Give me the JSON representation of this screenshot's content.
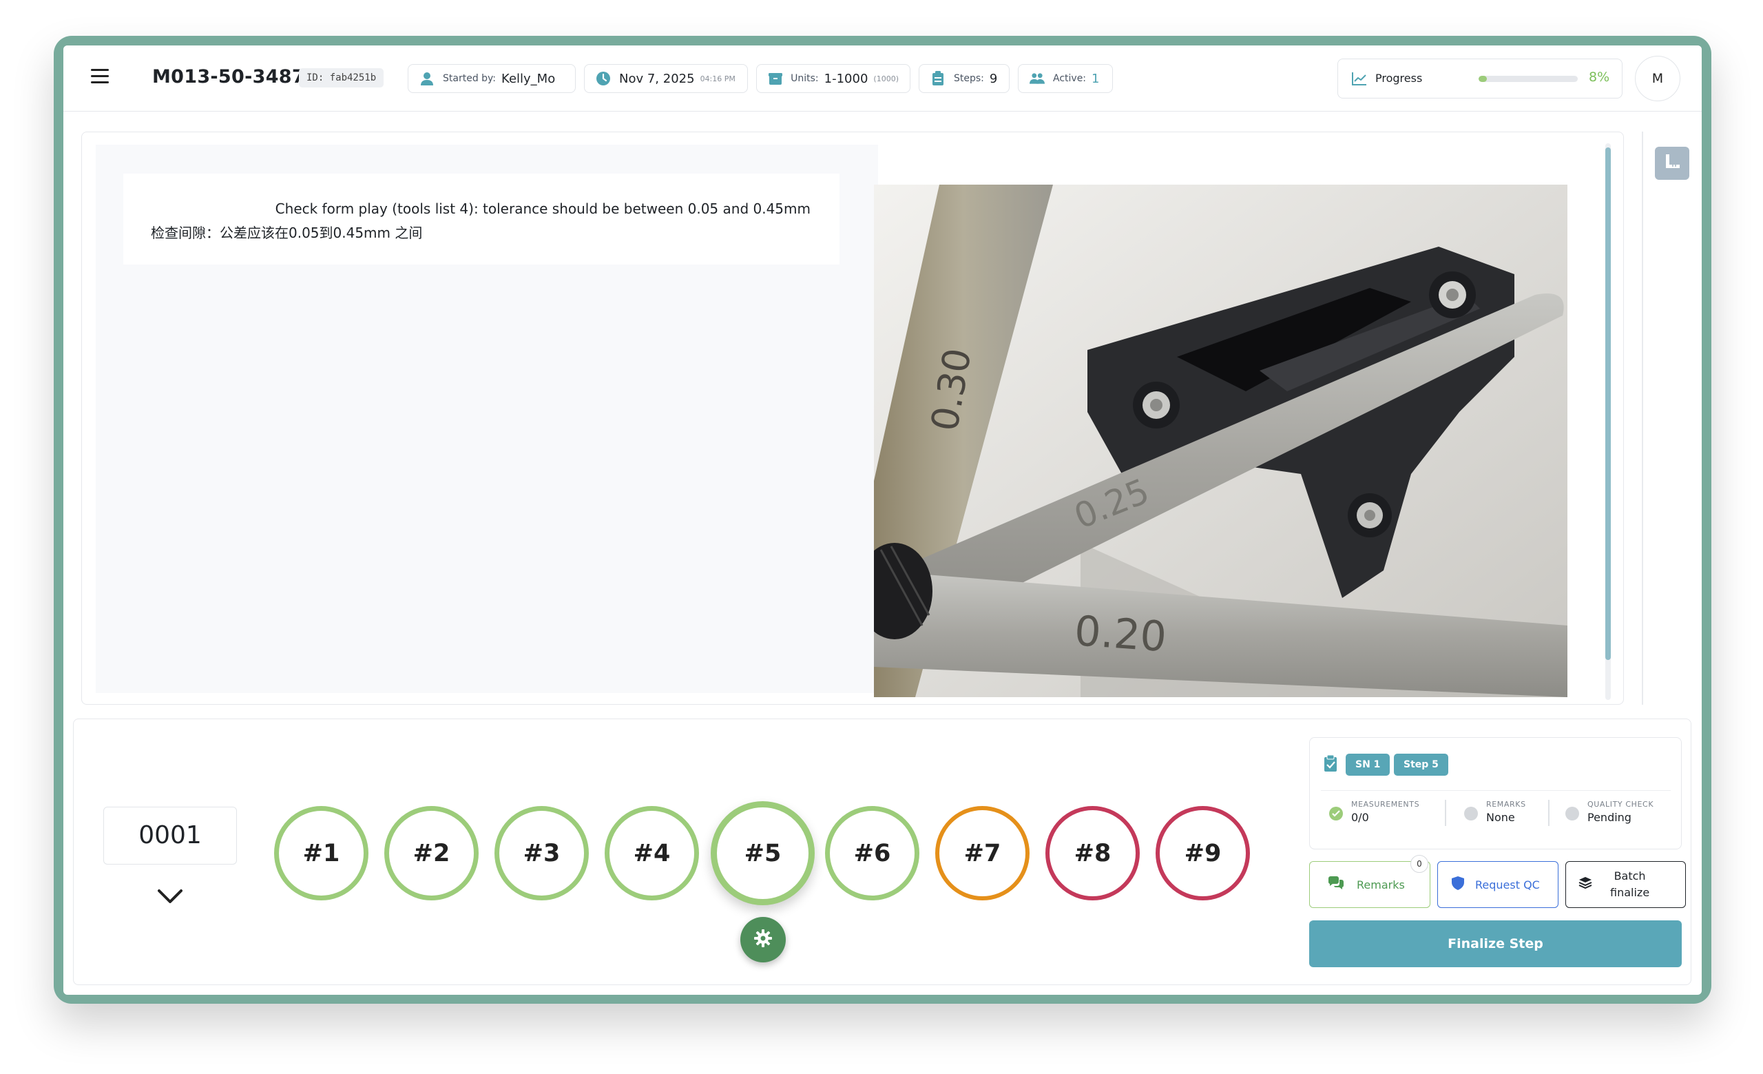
{
  "header": {
    "menu_icon": "hamburger-menu-icon",
    "title": "M013-50-3487",
    "id_badge": "ID: fab4251b",
    "started_by_label": "Started by:",
    "started_by_value": "Kelly_Mo",
    "date_value": "Nov 7, 2025",
    "date_time": "04:16 PM",
    "units_label": "Units:",
    "units_value": "1-1000",
    "units_sub": "(1000)",
    "steps_label": "Steps:",
    "steps_value": "9",
    "active_label": "Active:",
    "active_value": "1",
    "progress_label": "Progress",
    "progress_pct": "8%",
    "progress_fraction": 0.08,
    "avatar_initial": "M"
  },
  "instruction": {
    "english": "Check form play (tools list 4): tolerance should be between 0.05 and 0.45mm",
    "chinese": "检查间隙：公差应该在0.05到0.45mm 之间"
  },
  "photo": {
    "gauge_labels": [
      "0.30",
      "0.25",
      "0.20"
    ]
  },
  "unit": {
    "number": "0001"
  },
  "steps": [
    {
      "label": "#1",
      "state": "done"
    },
    {
      "label": "#2",
      "state": "done"
    },
    {
      "label": "#3",
      "state": "done"
    },
    {
      "label": "#4",
      "state": "done"
    },
    {
      "label": "#5",
      "state": "current"
    },
    {
      "label": "#6",
      "state": "done"
    },
    {
      "label": "#7",
      "state": "warn"
    },
    {
      "label": "#8",
      "state": "bad"
    },
    {
      "label": "#9",
      "state": "bad"
    }
  ],
  "status": {
    "sn_tag": "SN 1",
    "step_tag": "Step 5",
    "measurements_label": "MEASUREMENTS",
    "measurements_value": "0/0",
    "remarks_label": "REMARKS",
    "remarks_value": "None",
    "qc_label": "QUALITY CHECK",
    "qc_value": "Pending"
  },
  "actions": {
    "remarks_label": "Remarks",
    "remarks_count": "0",
    "request_qc_label": "Request QC",
    "batch_label_line1": "Batch",
    "batch_label_line2": "finalize",
    "finalize_label": "Finalize Step"
  },
  "colors": {
    "frame": "#78ab9c",
    "done": "#9ccc7a",
    "warn": "#e5901a",
    "bad": "#c4395a",
    "accent": "#5aa7b8",
    "qc_blue": "#3b6fd9",
    "gear_green": "#4e8e5a"
  }
}
